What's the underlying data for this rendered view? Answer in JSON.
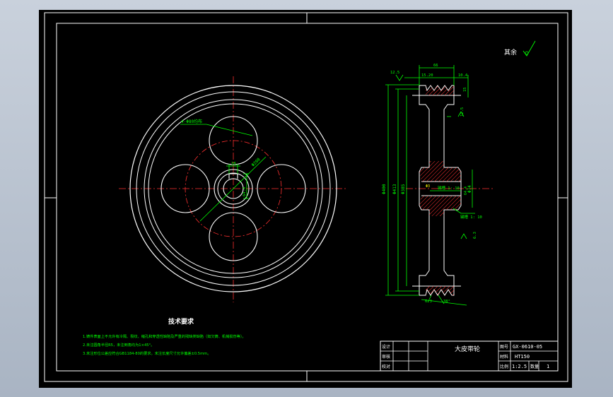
{
  "roughness_note": "其余",
  "tech_req": {
    "title": "技术要求",
    "lines": [
      "1.铸件表面上不允许有冷隔、裂纹、缩孔和穿透性缺陷及严重的残缺类缺陷（如欠铸、机械损伤等）。",
      "2.未注圆角半径R5，未注倒角均为1×45°。",
      "3.未注形位公差应符合GB1184-80的要求。未注长度尺寸允许偏差±0.5mm。"
    ]
  },
  "front_view": {
    "hole_note": "4-Φ80均布",
    "pcd_label": "Φ200",
    "keyway_width": "18",
    "keyway_depth": "64.4"
  },
  "side_view": {
    "dims_top": [
      "66",
      "15.20",
      "10.4",
      "12.5"
    ],
    "right_dims": [
      "15",
      "12.5"
    ],
    "dia_labels": [
      "Φ400",
      "Φ413",
      "Φ385",
      "Φ74"
    ],
    "hub_labels": [
      "键槽 1: 10",
      "键槽 1: 10"
    ],
    "side_small": [
      "Φ3",
      "64.4",
      "6.3"
    ],
    "bottom_dims": [
      "6.3",
      "38°"
    ]
  },
  "title_block": {
    "part_name": "大皮带轮",
    "drawing_no": "GX-0610-05",
    "material": "HT150",
    "scale": "1:2.5",
    "quantity": "1",
    "labels_left": [
      "设计",
      "审核",
      "校对"
    ],
    "labels_right": [
      "图号",
      "材料",
      "比例",
      "数量"
    ]
  },
  "colors": {
    "white": "#ffffff",
    "green": "#00ff00",
    "red": "#ff2a2a",
    "cyan": "#00ffff",
    "yellow": "#ffff00"
  }
}
